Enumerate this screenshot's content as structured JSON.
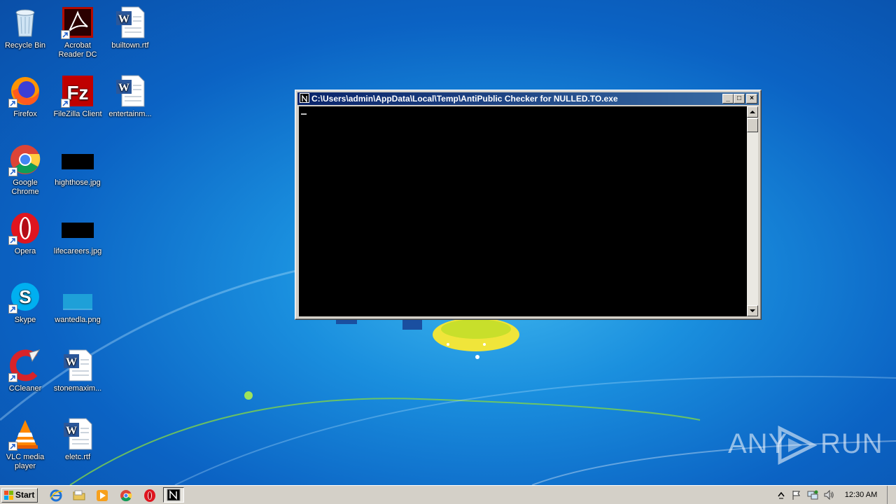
{
  "desktop": {
    "icons": [
      {
        "label": "Recycle Bin",
        "icon": "recycle-bin-icon"
      },
      {
        "label": "Acrobat Reader DC",
        "icon": "acrobat-icon"
      },
      {
        "label": "builtown.rtf",
        "icon": "word-document-icon"
      },
      {
        "label": "Firefox",
        "icon": "firefox-icon"
      },
      {
        "label": "FileZilla Client",
        "icon": "filezilla-icon"
      },
      {
        "label": "entertainm...",
        "icon": "word-document-icon"
      },
      {
        "label": "Google Chrome",
        "icon": "chrome-icon"
      },
      {
        "label": "highthose.jpg",
        "icon": "image-thumbnail-icon"
      },
      {
        "label": "Opera",
        "icon": "opera-icon"
      },
      {
        "label": "lifecareers.jpg",
        "icon": "image-thumbnail-icon"
      },
      {
        "label": "Skype",
        "icon": "skype-icon"
      },
      {
        "label": "wantedla.png",
        "icon": "image-thumbnail-icon"
      },
      {
        "label": "CCleaner",
        "icon": "ccleaner-icon"
      },
      {
        "label": "stonemaxim...",
        "icon": "word-document-icon"
      },
      {
        "label": "VLC media player",
        "icon": "vlc-icon"
      },
      {
        "label": "eletc.rtf",
        "icon": "word-document-icon"
      }
    ]
  },
  "window": {
    "title": "C:\\Users\\admin\\AppData\\Local\\Temp\\AntiPublic Checker for NULLED.TO.exe",
    "minimize": "_",
    "maximize": "□",
    "close": "×"
  },
  "taskbar": {
    "start_label": "Start",
    "quick_launch": [
      "internet-explorer-icon",
      "folder-icon",
      "media-player-icon",
      "chrome-icon",
      "opera-icon"
    ],
    "active_task_icon": "console-app-icon",
    "clock": "12:30 AM",
    "tray_icons": [
      "show-hidden-icons-icon",
      "action-center-flag-icon",
      "network-icon",
      "volume-icon"
    ]
  },
  "watermark": {
    "left": "ANY",
    "right": "RUN"
  },
  "colors": {
    "title_active": "#0a246a",
    "console_bg": "#000000",
    "desktop": "#1a8fde"
  }
}
